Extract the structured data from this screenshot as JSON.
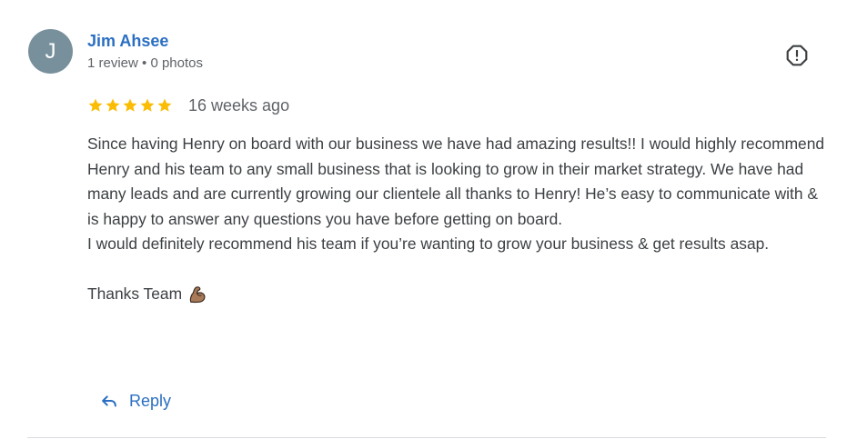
{
  "review": {
    "avatar_letter": "J",
    "avatar_color": "#78909c",
    "author_name": "Jim Ahsee",
    "author_meta": "1 review • 0 photos",
    "rating": 5,
    "rating_max": 5,
    "star_color": "#fbbc04",
    "date": "16 weeks ago",
    "body_paragraphs": [
      "Since having Henry on board with our business we have had amazing results!! I would highly recommend Henry and his team to any small business that is looking to grow in their market strategy. We have had many leads and are currently growing our clientele all thanks to Henry! He’s easy to communicate with & is happy to answer any questions you have before getting on board.",
      "I would definitely recommend his team if you’re wanting to grow your business & get results asap."
    ],
    "signoff": "Thanks Team",
    "signoff_emoji_icon": "flexed-biceps-icon"
  },
  "actions": {
    "reply_label": "Reply",
    "reply_icon": "reply-arrow-icon",
    "flag_icon": "report-flag-icon",
    "accent_color": "#2b6fc2"
  }
}
